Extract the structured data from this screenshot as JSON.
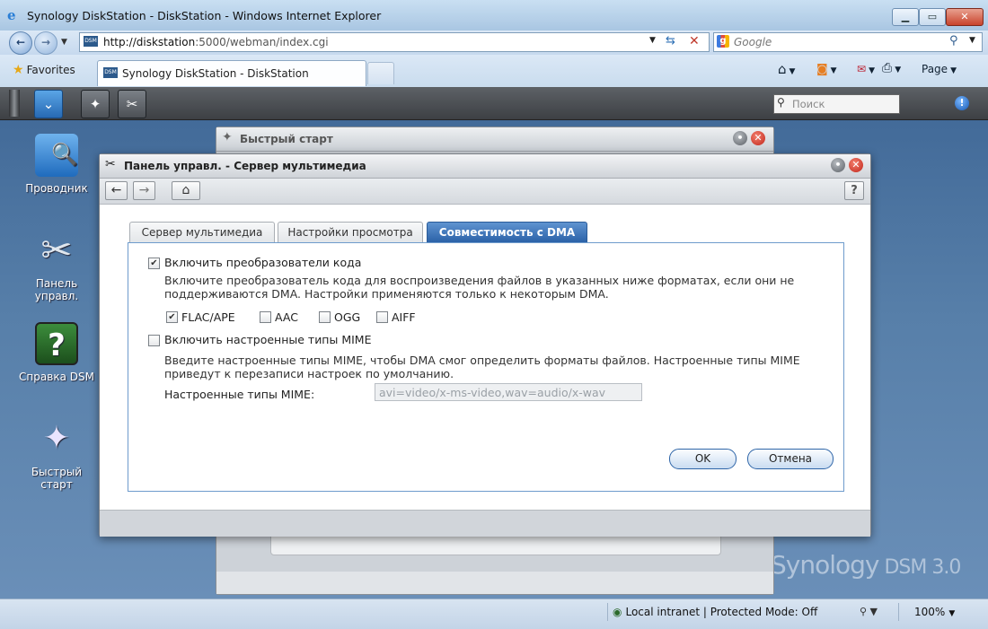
{
  "browser": {
    "title": "Synology DiskStation - DiskStation - Windows Internet Explorer",
    "address_domain": "http://diskstation",
    "address_path": ":5000/webman/index.cgi",
    "search_placeholder": "Google",
    "favorites_label": "Favorites",
    "tab_label": "Synology DiskStation - DiskStation",
    "favicon_text": "DSM",
    "page_menu": "Page",
    "status_zone": "Local intranet | Protected Mode: Off",
    "zoom": "100%"
  },
  "dsm": {
    "search_placeholder": "Поиск",
    "brand": "Synology",
    "brand_version": "DSM 3.0",
    "desktop_icons": [
      {
        "label": "Проводник"
      },
      {
        "label": "Панель управл."
      },
      {
        "label": "Справка DSM"
      },
      {
        "label": "Быстрый старт"
      }
    ],
    "quickstart_title": "Быстрый старт"
  },
  "control_panel": {
    "title": "Панель управл. - Сервер мультимедиа",
    "tabs": [
      {
        "label": "Сервер мультимедиа",
        "active": false
      },
      {
        "label": "Настройки просмотра",
        "active": false
      },
      {
        "label": "Совместимость с DMA",
        "active": true
      }
    ],
    "enable_transcoder": {
      "label": "Включить преобразователи кода",
      "checked": true
    },
    "transcoder_desc": "Включите преобразователь кода для воспроизведения файлов в указанных ниже форматах, если они не поддерживаются DMA. Настройки применяются только к некоторым DMA.",
    "formats": [
      {
        "label": "FLAC/APE",
        "checked": true
      },
      {
        "label": "AAC",
        "checked": false
      },
      {
        "label": "OGG",
        "checked": false
      },
      {
        "label": "AIFF",
        "checked": false
      }
    ],
    "enable_mime": {
      "label": "Включить настроенные типы MIME",
      "checked": false
    },
    "mime_desc": "Введите настроенные типы MIME, чтобы DMA смог определить форматы файлов. Настроенные типы MIME приведут к перезаписи настроек по умолчанию.",
    "mime_field_label": "Настроенные типы MIME:",
    "mime_placeholder": "avi=video/x-ms-video,wav=audio/x-wav",
    "ok_label": "OK",
    "cancel_label": "Отмена"
  }
}
